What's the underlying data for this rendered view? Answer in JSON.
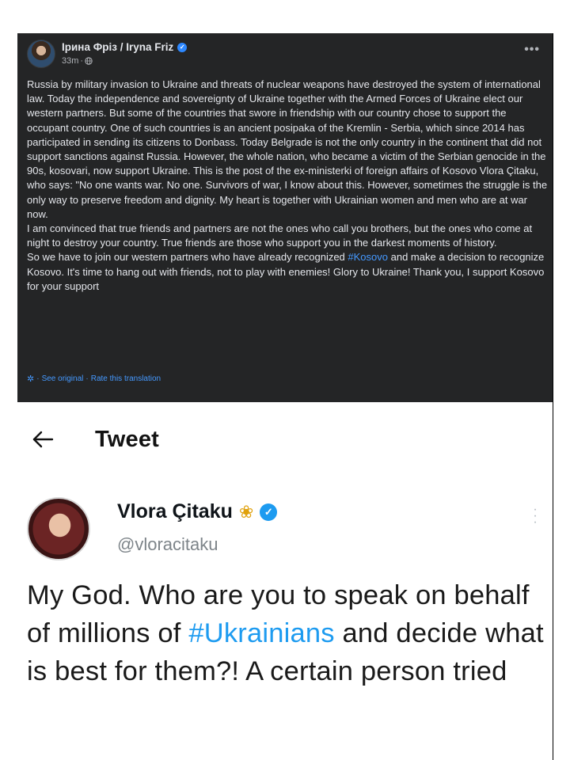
{
  "facebook_post": {
    "author": "Ірина Фріз / Iryna Friz",
    "time": "33m",
    "time_separator": "·",
    "more_icon": "ellipsis-icon",
    "paragraphs": [
      "Russia by military invasion to Ukraine and threats of nuclear weapons have destroyed the system of international law. Today the independence and sovereignty of Ukraine together with the Armed Forces of Ukraine elect our western partners. But some of the countries that swore in friendship with our country chose to support the occupant country. One of such countries is an ancient posipaka of the Kremlin - Serbia, which since 2014 has participated in sending its citizens to Donbass. Today Belgrade is not the only country in the continent that did not support sanctions against Russia. However, the whole nation, who became a victim of the Serbian genocide in the 90s, kosovari, now support Ukraine. This is the post of the ex-ministerki of foreign affairs of Kosovo Vlora Çitaku, who says: \"No one wants war. No one. Survivors of war, I know about this. However, sometimes the struggle is the only way to preserve freedom and dignity. My heart is together with Ukrainian women and men who are at war now.",
      "I am convinced that true friends and partners are not the ones who call you brothers, but the ones who come at night to destroy your country. True friends are those who support you in the darkest moments of history."
    ],
    "last_paragraph": {
      "before": "So we have to join our western partners who have already recognized ",
      "hashtag": "#Kosovo",
      "after": " and make a decision to recognize Kosovo. It's time to hang out with friends, not to play with enemies! Glory to Ukraine! Thank you, I support Kosovo for your support"
    },
    "translation": {
      "see_original": "See original",
      "rate": "Rate this translation",
      "separator": "·"
    }
  },
  "tweet": {
    "header_title": "Tweet",
    "name": "Vlora Çitaku",
    "handle": "@vloracitaku",
    "text_before": "My God. Who are you to speak on behalf of millions of ",
    "hashtag": "#Ukrainians",
    "text_after": " and decide what is best for them?! A certain person tried"
  },
  "colors": {
    "fb_background": "#242526",
    "fb_link": "#4599ff",
    "twitter_blue": "#1d9bf0"
  }
}
